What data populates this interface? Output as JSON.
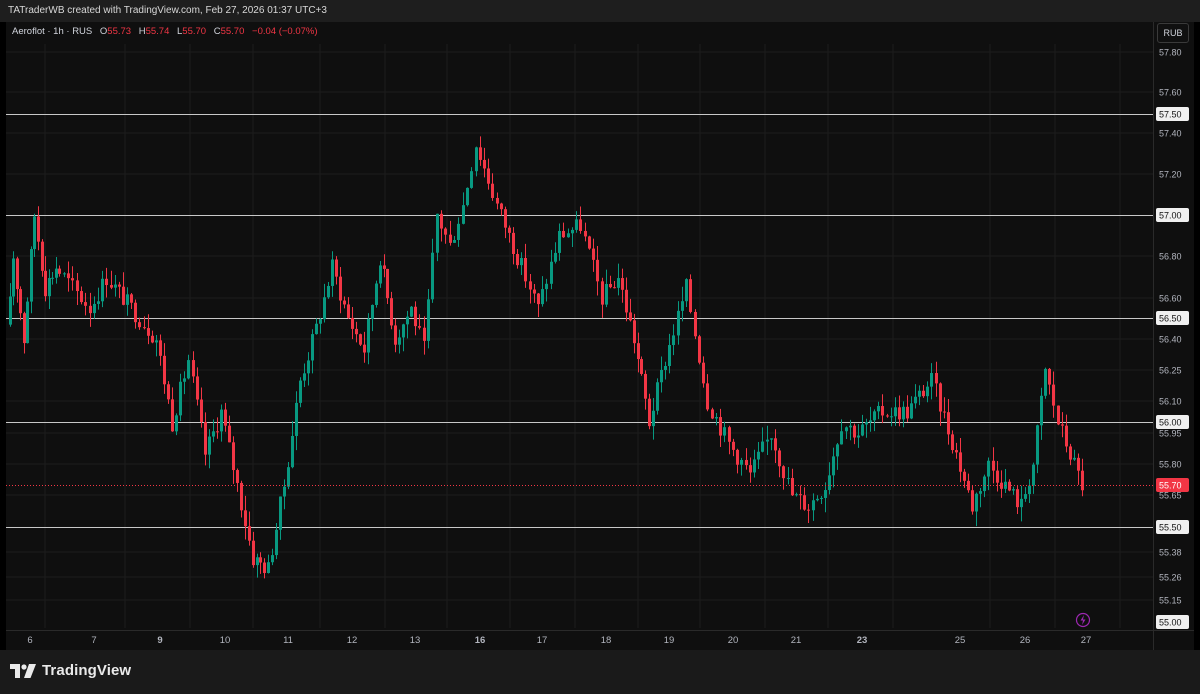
{
  "header": {
    "created_text": "TATraderWB created with TradingView.com, Feb 27, 2026 01:37 UTC+3"
  },
  "legend": {
    "symbol": "Aeroflot · 1h · RUS",
    "o_label": "O",
    "o_value": "55.73",
    "h_label": "H",
    "h_value": "55.74",
    "l_label": "L",
    "l_value": "55.70",
    "c_label": "C",
    "c_value": "55.70",
    "change": "−0.04 (−0.07%)"
  },
  "currency": "RUB",
  "footer": {
    "brand": "TradingView"
  },
  "colors": {
    "up": "#089981",
    "down": "#f23645",
    "level_line": "#c8c8c8",
    "price_tag": "#f23645",
    "alert_icon": "#9c27b0"
  },
  "chart_data": {
    "type": "candlestick",
    "title": "",
    "symbol": "Aeroflot",
    "interval": "1h",
    "exchange": "RUS",
    "currency": "RUB",
    "x_ticks": [
      {
        "label": "6",
        "bold": false
      },
      {
        "label": "7",
        "bold": false
      },
      {
        "label": "9",
        "bold": true
      },
      {
        "label": "10",
        "bold": false
      },
      {
        "label": "11",
        "bold": false
      },
      {
        "label": "12",
        "bold": false
      },
      {
        "label": "13",
        "bold": false
      },
      {
        "label": "16",
        "bold": true
      },
      {
        "label": "17",
        "bold": false
      },
      {
        "label": "18",
        "bold": false
      },
      {
        "label": "19",
        "bold": false
      },
      {
        "label": "20",
        "bold": false
      },
      {
        "label": "21",
        "bold": false
      },
      {
        "label": "23",
        "bold": true
      },
      {
        "label": "25",
        "bold": false
      },
      {
        "label": "26",
        "bold": false
      },
      {
        "label": "27",
        "bold": false
      }
    ],
    "y_ticks": [
      {
        "value": 57.8,
        "label": "57.80"
      },
      {
        "value": 57.6,
        "label": "57.60"
      },
      {
        "value": 57.4,
        "label": "57.40"
      },
      {
        "value": 57.2,
        "label": "57.20"
      },
      {
        "value": 56.8,
        "label": "56.80"
      },
      {
        "value": 56.6,
        "label": "56.60"
      },
      {
        "value": 56.4,
        "label": "56.40"
      },
      {
        "value": 56.25,
        "label": "56.25"
      },
      {
        "value": 56.1,
        "label": "56.10"
      },
      {
        "value": 55.95,
        "label": "55.95"
      },
      {
        "value": 55.8,
        "label": "55.80"
      },
      {
        "value": 55.65,
        "label": "55.65"
      },
      {
        "value": 55.38,
        "label": "55.38"
      },
      {
        "value": 55.26,
        "label": "55.26"
      },
      {
        "value": 55.15,
        "label": "55.15"
      }
    ],
    "horizontal_levels": [
      {
        "value": 57.5,
        "label": "57.50"
      },
      {
        "value": 57.0,
        "label": "57.00"
      },
      {
        "value": 56.5,
        "label": "56.50"
      },
      {
        "value": 56.0,
        "label": "56.00"
      },
      {
        "value": 55.5,
        "label": "55.50"
      }
    ],
    "bottom_level": {
      "value": 55.0,
      "label": "55.00"
    },
    "last_price": {
      "value": 55.7,
      "label": "55.70"
    },
    "path": [
      {
        "d": "6",
        "p": 56.25
      },
      {
        "d": "6",
        "p": 56.8
      },
      {
        "d": "6",
        "p": 56.4
      },
      {
        "d": "6",
        "p": 57.0
      },
      {
        "d": "6",
        "p": 56.65
      },
      {
        "d": "6",
        "p": 56.75
      },
      {
        "d": "7",
        "p": 56.55
      },
      {
        "d": "7",
        "p": 56.7
      },
      {
        "d": "7",
        "p": 56.6
      },
      {
        "d": "7",
        "p": 56.5
      },
      {
        "d": "9",
        "p": 56.4
      },
      {
        "d": "9",
        "p": 56.0
      },
      {
        "d": "9",
        "p": 56.3
      },
      {
        "d": "9",
        "p": 55.85
      },
      {
        "d": "10",
        "p": 56.05
      },
      {
        "d": "10",
        "p": 55.7
      },
      {
        "d": "10",
        "p": 55.35
      },
      {
        "d": "10",
        "p": 55.3
      },
      {
        "d": "11",
        "p": 55.7
      },
      {
        "d": "11",
        "p": 56.2
      },
      {
        "d": "11",
        "p": 56.45
      },
      {
        "d": "11",
        "p": 56.75
      },
      {
        "d": "12",
        "p": 56.5
      },
      {
        "d": "12",
        "p": 56.35
      },
      {
        "d": "12",
        "p": 56.8
      },
      {
        "d": "12",
        "p": 56.4
      },
      {
        "d": "13",
        "p": 56.55
      },
      {
        "d": "13",
        "p": 56.35
      },
      {
        "d": "13",
        "p": 57.0
      },
      {
        "d": "13",
        "p": 56.85
      },
      {
        "d": "13",
        "p": 57.05
      },
      {
        "d": "16",
        "p": 57.35
      },
      {
        "d": "16",
        "p": 57.05
      },
      {
        "d": "16",
        "p": 56.8
      },
      {
        "d": "17",
        "p": 56.55
      },
      {
        "d": "17",
        "p": 56.9
      },
      {
        "d": "17",
        "p": 56.95
      },
      {
        "d": "18",
        "p": 56.6
      },
      {
        "d": "18",
        "p": 56.7
      },
      {
        "d": "18",
        "p": 56.4
      },
      {
        "d": "18",
        "p": 56.0
      },
      {
        "d": "19",
        "p": 56.3
      },
      {
        "d": "19",
        "p": 56.65
      },
      {
        "d": "19",
        "p": 56.1
      },
      {
        "d": "20",
        "p": 55.9
      },
      {
        "d": "20",
        "p": 55.75
      },
      {
        "d": "20",
        "p": 55.95
      },
      {
        "d": "21",
        "p": 55.65
      },
      {
        "d": "21",
        "p": 55.6
      },
      {
        "d": "21",
        "p": 55.7
      },
      {
        "d": "21",
        "p": 56.0
      },
      {
        "d": "23",
        "p": 55.95
      },
      {
        "d": "23",
        "p": 56.05
      },
      {
        "d": "23",
        "p": 56.05
      },
      {
        "d": "23",
        "p": 56.2
      },
      {
        "d": "25",
        "p": 55.85
      },
      {
        "d": "25",
        "p": 55.6
      },
      {
        "d": "25",
        "p": 55.8
      },
      {
        "d": "25",
        "p": 55.7
      },
      {
        "d": "26",
        "p": 55.6
      },
      {
        "d": "26",
        "p": 55.8
      },
      {
        "d": "26",
        "p": 56.25
      },
      {
        "d": "26",
        "p": 56.0
      },
      {
        "d": "26",
        "p": 55.85
      },
      {
        "d": "27",
        "p": 55.7
      }
    ]
  }
}
